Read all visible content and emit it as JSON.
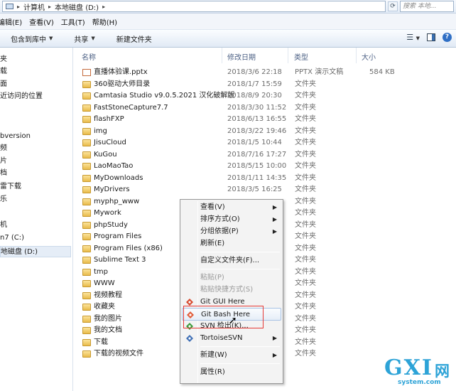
{
  "address": {
    "path": [
      "计算机",
      "本地磁盘 (D:)"
    ],
    "search_placeholder": "搜索 本地..."
  },
  "menu": [
    "编辑(E)",
    "查看(V)",
    "工具(T)",
    "帮助(H)"
  ],
  "toolbar": {
    "include": "包含到库中",
    "share": "共享",
    "new_folder": "新建文件夹"
  },
  "nav_items": [
    "夹",
    "载",
    "面",
    "近访问的位置",
    "bversion",
    "频",
    "片",
    "档",
    "雷下载",
    "乐",
    "机",
    "n7 (C:)",
    "地磁盘 (D:)"
  ],
  "columns": {
    "name": "名称",
    "modified": "修改日期",
    "type": "类型",
    "size": "大小"
  },
  "files": [
    {
      "name": "直播体验课.pptx",
      "date": "2018/3/6 22:18",
      "type": "PPTX 演示文稿",
      "size": "584 KB",
      "icon": "pptx-icon"
    },
    {
      "name": "360驱动大师目录",
      "date": "2018/1/7 15:59",
      "type": "文件夹",
      "size": "",
      "icon": "folder-icon"
    },
    {
      "name": "Camtasia Studio v9.0.5.2021 汉化破解版",
      "date": "2018/8/9 20:30",
      "type": "文件夹",
      "size": "",
      "icon": "folder-icon"
    },
    {
      "name": "FastStoneCapture7.7",
      "date": "2018/3/30 11:52",
      "type": "文件夹",
      "size": "",
      "icon": "folder-icon"
    },
    {
      "name": "flashFXP",
      "date": "2018/6/13 16:55",
      "type": "文件夹",
      "size": "",
      "icon": "folder-icon"
    },
    {
      "name": "img",
      "date": "2018/3/22 19:46",
      "type": "文件夹",
      "size": "",
      "icon": "folder-icon"
    },
    {
      "name": "JisuCloud",
      "date": "2018/1/5 10:44",
      "type": "文件夹",
      "size": "",
      "icon": "folder-icon"
    },
    {
      "name": "KuGou",
      "date": "2018/7/16 17:27",
      "type": "文件夹",
      "size": "",
      "icon": "folder-icon"
    },
    {
      "name": "LaoMaoTao",
      "date": "2018/5/15 10:00",
      "type": "文件夹",
      "size": "",
      "icon": "folder-icon"
    },
    {
      "name": "MyDownloads",
      "date": "2018/1/11 14:35",
      "type": "文件夹",
      "size": "",
      "icon": "folder-icon"
    },
    {
      "name": "MyDrivers",
      "date": "2018/3/5 16:25",
      "type": "文件夹",
      "size": "",
      "icon": "folder-icon"
    },
    {
      "name": "myphp_www",
      "date": "",
      "type": "文件夹",
      "size": "",
      "icon": "folder-icon"
    },
    {
      "name": "Mywork",
      "date": "",
      "type": "文件夹",
      "size": "",
      "icon": "folder-icon"
    },
    {
      "name": "phpStudy",
      "date": "",
      "type": "文件夹",
      "size": "",
      "icon": "folder-icon"
    },
    {
      "name": "Program Files",
      "date": "",
      "type": "文件夹",
      "size": "",
      "icon": "folder-icon"
    },
    {
      "name": "Program Files (x86)",
      "date": "",
      "type": "文件夹",
      "size": "",
      "icon": "folder-icon"
    },
    {
      "name": "Sublime Text 3",
      "date": "",
      "type": "文件夹",
      "size": "",
      "icon": "folder-icon"
    },
    {
      "name": "tmp",
      "date": "",
      "type": "文件夹",
      "size": "",
      "icon": "folder-icon"
    },
    {
      "name": "WWW",
      "date": "",
      "type": "文件夹",
      "size": "",
      "icon": "folder-icon"
    },
    {
      "name": "视频教程",
      "date": "",
      "type": "文件夹",
      "size": "",
      "icon": "folder-icon"
    },
    {
      "name": "收藏夹",
      "date": "",
      "type": "文件夹",
      "size": "",
      "icon": "folder-icon"
    },
    {
      "name": "我的图片",
      "date": "",
      "type": "文件夹",
      "size": "",
      "icon": "folder-icon"
    },
    {
      "name": "我的文档",
      "date": "",
      "type": "文件夹",
      "size": "",
      "icon": "folder-icon"
    },
    {
      "name": "下载",
      "date": "",
      "type": "文件夹",
      "size": "",
      "icon": "folder-icon"
    },
    {
      "name": "下载的视频文件",
      "date": "",
      "type": "文件夹",
      "size": "",
      "icon": "folder-icon"
    }
  ],
  "context_menu": [
    {
      "label": "查看(V)",
      "submenu": true
    },
    {
      "label": "排序方式(O)",
      "submenu": true
    },
    {
      "label": "分组依据(P)",
      "submenu": true
    },
    {
      "label": "刷新(E)"
    },
    {
      "separator": true
    },
    {
      "label": "自定义文件夹(F)..."
    },
    {
      "separator": true
    },
    {
      "label": "粘贴(P)",
      "disabled": true
    },
    {
      "label": "粘贴快捷方式(S)",
      "disabled": true
    },
    {
      "label": "Git GUI Here",
      "icon": "git-gui-icon"
    },
    {
      "label": "Git Bash Here",
      "icon": "git-bash-icon",
      "hover": true
    },
    {
      "label": "SVN 检出(K)...",
      "icon": "svn-checkout-icon"
    },
    {
      "label": "TortoiseSVN",
      "icon": "tortoisesvn-icon",
      "submenu": true
    },
    {
      "separator": true
    },
    {
      "label": "新建(W)",
      "submenu": true
    },
    {
      "separator": true
    },
    {
      "label": "属性(R)"
    }
  ],
  "watermark": {
    "logo": "GXI",
    "logo_cn": "网",
    "url": "system.com"
  },
  "colors": {
    "highlight_box": "#e53935",
    "brand": "#2da3d7"
  }
}
